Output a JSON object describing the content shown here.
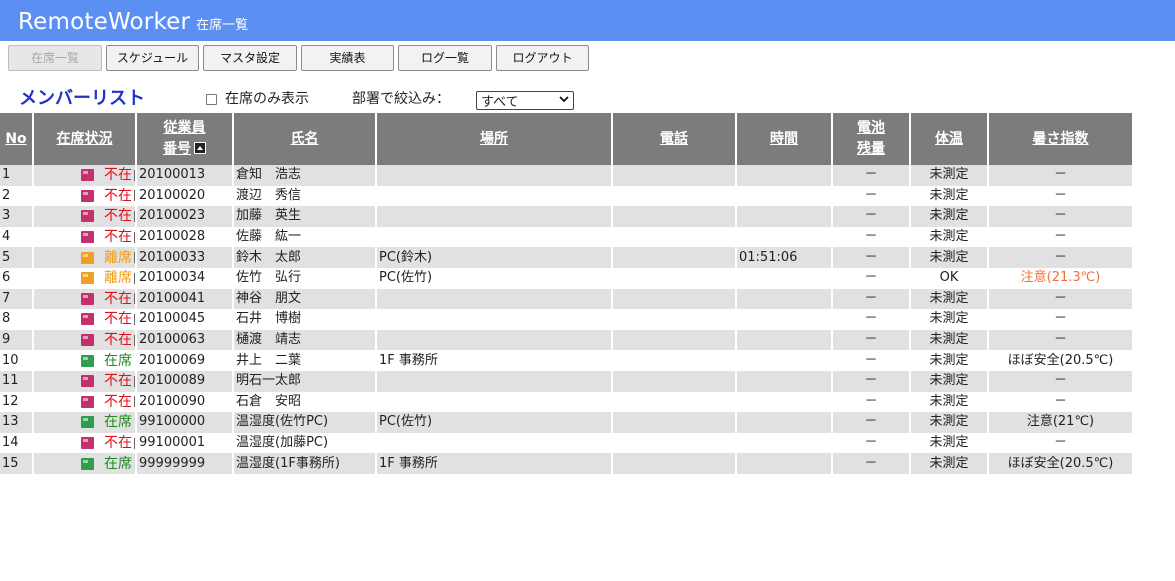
{
  "header": {
    "app_name": "RemoteWorker",
    "page_name": "在席一覧"
  },
  "toolbar": {
    "buttons": [
      {
        "label": "在席一覧",
        "disabled": true
      },
      {
        "label": "スケジュール"
      },
      {
        "label": "マスタ設定"
      },
      {
        "label": "実績表"
      },
      {
        "label": "ログ一覧"
      },
      {
        "label": "ログアウト"
      }
    ]
  },
  "controls": {
    "list_title": "メンバーリスト",
    "present_only_label": "在席のみ表示",
    "dept_label": "部署で絞込み：",
    "dept_selected": "すべて"
  },
  "table": {
    "headers": {
      "no": "No",
      "status": "在席状況",
      "emp_no_line1": "従業員",
      "emp_no_line2": "番号",
      "name": "氏名",
      "place": "場所",
      "phone": "電話",
      "time": "時間",
      "battery_line1": "電池",
      "battery_line2": "残量",
      "temp": "体温",
      "heat_index": "暑さ指数"
    },
    "rows": [
      {
        "no": "1",
        "status": "不在",
        "state": "absent",
        "emp": "20100013",
        "name": "倉知　浩志",
        "place": "",
        "phone": "",
        "time": "",
        "battery": "－",
        "temp": "未測定",
        "heat": "－"
      },
      {
        "no": "2",
        "status": "不在",
        "state": "absent",
        "emp": "20100020",
        "name": "渡辺　秀信",
        "place": "",
        "phone": "",
        "time": "",
        "battery": "－",
        "temp": "未測定",
        "heat": "－"
      },
      {
        "no": "3",
        "status": "不在",
        "state": "absent",
        "emp": "20100023",
        "name": "加藤　英生",
        "place": "",
        "phone": "",
        "time": "",
        "battery": "－",
        "temp": "未測定",
        "heat": "－"
      },
      {
        "no": "4",
        "status": "不在",
        "state": "absent",
        "emp": "20100028",
        "name": "佐藤　紘一",
        "place": "",
        "phone": "",
        "time": "",
        "battery": "－",
        "temp": "未測定",
        "heat": "－"
      },
      {
        "no": "5",
        "status": "離席",
        "state": "away",
        "emp": "20100033",
        "name": "鈴木　太郎",
        "place": "PC(鈴木)",
        "phone": "",
        "time": "01:51:06",
        "battery": "－",
        "temp": "未測定",
        "heat": "－"
      },
      {
        "no": "6",
        "status": "離席",
        "state": "away",
        "emp": "20100034",
        "name": "佐竹　弘行",
        "place": "PC(佐竹)",
        "phone": "",
        "time": "",
        "battery": "－",
        "temp": "OK",
        "heat": "注意(21.3℃)",
        "heat_level": "warn-strong"
      },
      {
        "no": "7",
        "status": "不在",
        "state": "absent",
        "emp": "20100041",
        "name": "神谷　朋文",
        "place": "",
        "phone": "",
        "time": "",
        "battery": "－",
        "temp": "未測定",
        "heat": "－"
      },
      {
        "no": "8",
        "status": "不在",
        "state": "absent",
        "emp": "20100045",
        "name": "石井　博樹",
        "place": "",
        "phone": "",
        "time": "",
        "battery": "－",
        "temp": "未測定",
        "heat": "－"
      },
      {
        "no": "9",
        "status": "不在",
        "state": "absent",
        "emp": "20100063",
        "name": "樋渡　靖志",
        "place": "",
        "phone": "",
        "time": "",
        "battery": "－",
        "temp": "未測定",
        "heat": "－"
      },
      {
        "no": "10",
        "status": "在席",
        "state": "present",
        "emp": "20100069",
        "name": "井上　二葉",
        "place": "1F 事務所",
        "phone": "",
        "time": "",
        "battery": "－",
        "temp": "未測定",
        "heat": "ほぼ安全(20.5℃)"
      },
      {
        "no": "11",
        "status": "不在",
        "state": "absent",
        "emp": "20100089",
        "name": "明石一太郎",
        "place": "",
        "phone": "",
        "time": "",
        "battery": "－",
        "temp": "未測定",
        "heat": "－"
      },
      {
        "no": "12",
        "status": "不在",
        "state": "absent",
        "emp": "20100090",
        "name": "石倉　安昭",
        "place": "",
        "phone": "",
        "time": "",
        "battery": "－",
        "temp": "未測定",
        "heat": "－"
      },
      {
        "no": "13",
        "status": "在席",
        "state": "present",
        "emp": "99100000",
        "name": "温湿度(佐竹PC)",
        "place": "PC(佐竹)",
        "phone": "",
        "time": "",
        "battery": "－",
        "temp": "未測定",
        "heat": "注意(21℃)"
      },
      {
        "no": "14",
        "status": "不在",
        "state": "absent",
        "emp": "99100001",
        "name": "温湿度(加藤PC)",
        "place": "",
        "phone": "",
        "time": "",
        "battery": "－",
        "temp": "未測定",
        "heat": "－"
      },
      {
        "no": "15",
        "status": "在席",
        "state": "present",
        "emp": "99999999",
        "name": "温湿度(1F事務所)",
        "place": "1F 事務所",
        "phone": "",
        "time": "",
        "battery": "－",
        "temp": "未測定",
        "heat": "ほぼ安全(20.5℃)"
      }
    ]
  },
  "colors": {
    "header_bg": "#5b8ff2",
    "table_header_bg": "#7c7c7c",
    "absent_text": "#e0101a",
    "absent_icon": "#c4306b",
    "away_text": "#f09a12",
    "away_icon": "#f0a020",
    "present_text": "#1f8a1f",
    "present_icon": "#2f9d4f",
    "heat_warn_text": "#f07040",
    "list_title": "#1f33c4"
  },
  "icons": {
    "status_icon": "status-square-icon",
    "sort_icon": "sort-ascending-icon",
    "dropdown_icon": "chevron-down-icon"
  }
}
